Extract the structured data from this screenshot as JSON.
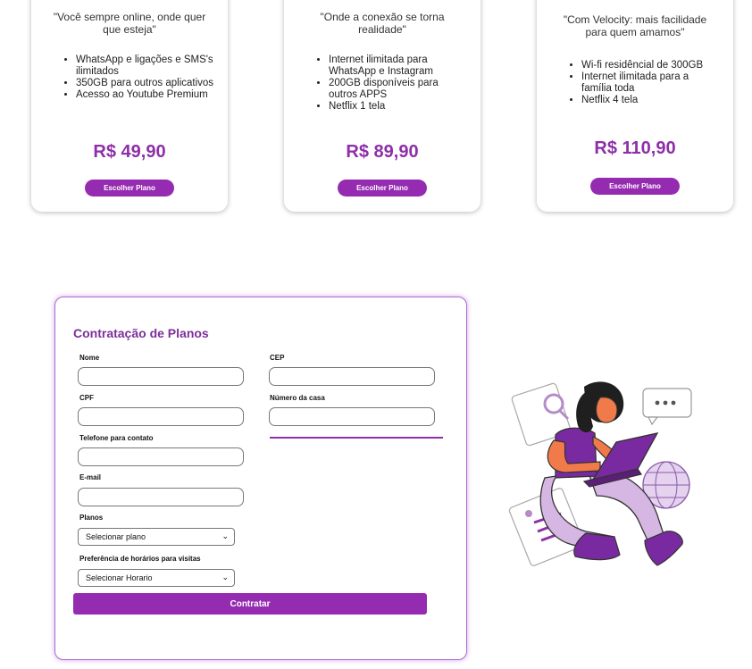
{
  "plans": [
    {
      "quote": "\"Você sempre online, onde quer que esteja\"",
      "features": [
        "WhatsApp e ligações e SMS's ilimitados",
        "350GB para outros aplicativos",
        "Acesso ao Youtube Premium"
      ],
      "price": "R$ 49,90",
      "button": "Escolher Plano"
    },
    {
      "quote": "\"Onde a conexão se torna realidade\"",
      "features": [
        "Internet ilimitada para WhatsApp e Instagram",
        "200GB disponíveis para outros APPS",
        "Netflix 1 tela"
      ],
      "price": "R$ 89,90",
      "button": "Escolher Plano"
    },
    {
      "quote": "\"Com Velocity: mais facilidade para quem amamos\"",
      "features": [
        "Wi-fi residêncial de 300GB",
        "Internet ilimitada para a família toda",
        "Netflix 4 tela"
      ],
      "price": "R$ 110,90",
      "button": "Escolher Plano"
    }
  ],
  "form": {
    "title": "Contratação de Planos",
    "labels": {
      "nome": "Nome",
      "cep": "CEP",
      "cpf": "CPF",
      "numero": "Número da casa",
      "telefone": "Telefone para contato",
      "email": "E-mail",
      "planos": "Planos",
      "horarios": "Preferência de horários para visitas"
    },
    "values": {
      "nome": "",
      "cep": "",
      "cpf": "",
      "numero": "",
      "telefone": "",
      "email": ""
    },
    "select_plano": "Selecionar plano",
    "select_horario": "Selecionar Horario",
    "submit": "Contratar"
  },
  "colors": {
    "accent": "#952bb0",
    "price": "#8e2fa8",
    "title": "#7d2f9a"
  },
  "icons": {
    "illustration": "person-with-laptop-illustration",
    "chevron": "chevron-down-icon"
  }
}
